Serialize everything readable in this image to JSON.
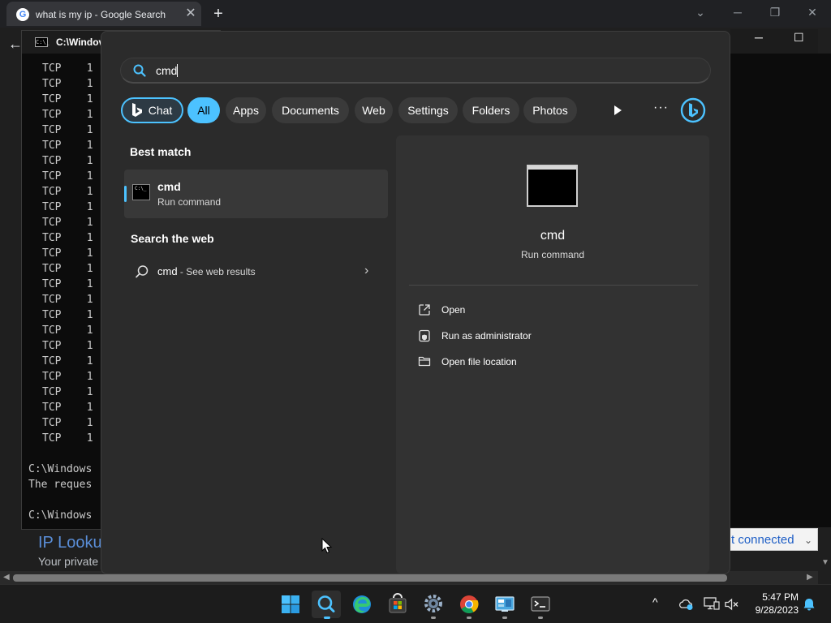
{
  "browser": {
    "tab_title": "what is my ip - Google Search",
    "tab_close": "✕",
    "new_tab": "+",
    "win_minimize": "─",
    "win_restore": "❐",
    "win_close": "✕",
    "win_collapse": "⌄",
    "favicon_letter": "G",
    "back": "←",
    "page_heading": "IP Looku",
    "page_snippet": "Your private",
    "wifi_status": "t connected"
  },
  "cmd": {
    "title": "C:\\Windov",
    "icon_text": "C:\\_",
    "lines": [
      "TCP    1",
      "TCP    1",
      "TCP    1",
      "TCP    1",
      "TCP    1",
      "TCP    1",
      "TCP    1",
      "TCP    1",
      "TCP    1",
      "TCP    1",
      "TCP    1",
      "TCP    1",
      "TCP    1",
      "TCP    1",
      "TCP    1",
      "TCP    1",
      "TCP    1",
      "TCP    1",
      "TCP    1",
      "TCP    1",
      "TCP    1",
      "TCP    1",
      "TCP    1",
      "TCP    1",
      "TCP    1"
    ],
    "prompt_1": "C:\\Windows",
    "response": "The reques",
    "prompt_2": "C:\\Windows",
    "minimize": "─",
    "maximize": "☐"
  },
  "search": {
    "query": "cmd",
    "filters": {
      "chat": "Chat",
      "all": "All",
      "apps": "Apps",
      "documents": "Documents",
      "web": "Web",
      "settings": "Settings",
      "folders": "Folders",
      "photos": "Photos",
      "more": "···"
    },
    "best_match": {
      "heading": "Best match",
      "name": "cmd",
      "subtitle": "Run command"
    },
    "web": {
      "heading": "Search the web",
      "query": "cmd",
      "suffix": " - See web results",
      "arrow": "›"
    },
    "detail": {
      "name": "cmd",
      "subtitle": "Run command",
      "actions": [
        "Open",
        "Run as administrator",
        "Open file location"
      ]
    }
  },
  "taskbar": {
    "time": "5:47 PM",
    "date": "9/28/2023",
    "tray_chevron": "^"
  },
  "colors": {
    "accent": "#4cc2ff",
    "panel": "#2b2b2b",
    "detail": "#323232"
  }
}
